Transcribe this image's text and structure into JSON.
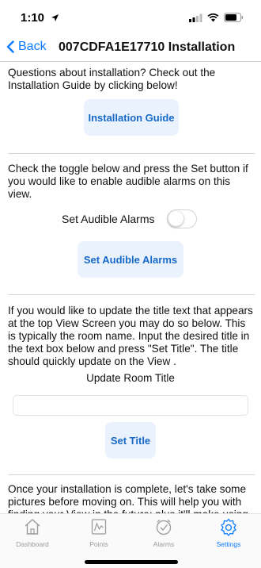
{
  "status_bar": {
    "time": "1:10"
  },
  "nav": {
    "back_label": "Back",
    "title": "007CDFA1E17710 Installation"
  },
  "sections": {
    "guide": {
      "text": "Questions about installation? Check out the Installation Guide by clicking below!",
      "button": "Installation Guide"
    },
    "alarms": {
      "text": "Check the toggle below and press the Set button if you would like to enable audible alarms on this view.",
      "toggle_label": "Set Audible Alarms",
      "toggle_on": false,
      "button": "Set Audible Alarms"
    },
    "title": {
      "text": "If you would like to update the title text that appears at the top View Screen you may do so below.  This is typically the room name.  Input the desired title in the text box below and press \"Set Title\".  The title should quickly update on the View .",
      "label": "Update Room Title",
      "input_value": "",
      "button": "Set Title"
    },
    "pictures": {
      "text": "Once your installation is complete, let's take some pictures before moving on. This will help you with finding your View in the future; plus it'll make using"
    }
  },
  "tabs": [
    {
      "label": "Dashboard",
      "icon": "house-icon"
    },
    {
      "label": "Points",
      "icon": "chart-icon"
    },
    {
      "label": "Alarms",
      "icon": "alarm-check-icon"
    },
    {
      "label": "Settings",
      "icon": "gear-icon"
    }
  ],
  "colors": {
    "accent": "#0a7aff",
    "button_bg": "#eaf3fd",
    "button_text": "#1669c9"
  }
}
